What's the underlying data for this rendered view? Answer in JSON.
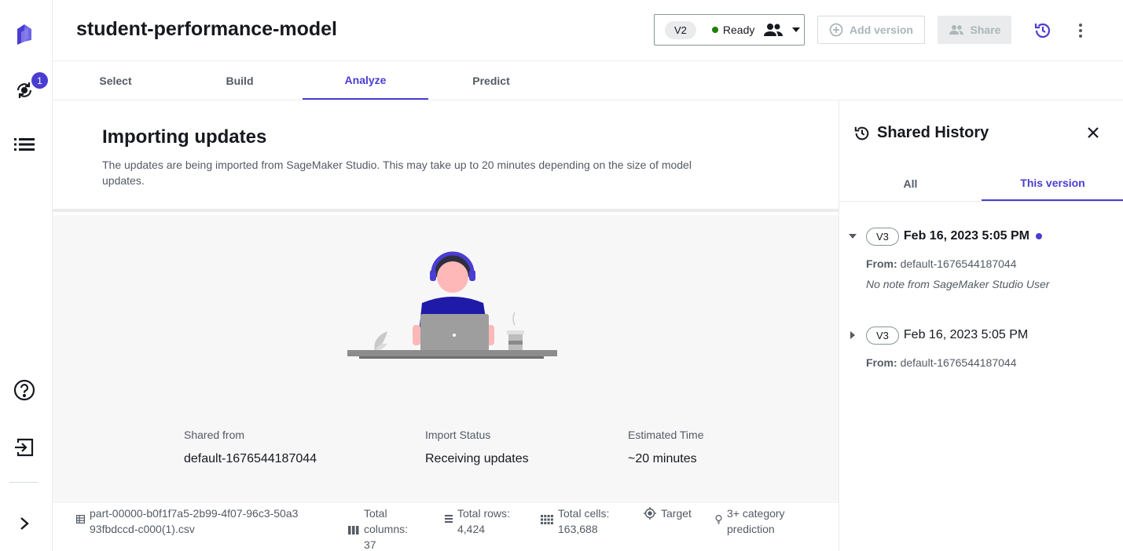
{
  "header": {
    "model_name": "student-performance-model",
    "version": "V2",
    "status": "Ready",
    "add_version_label": "Add version",
    "share_label": "Share"
  },
  "rail": {
    "notification_count": "1"
  },
  "tabs": [
    {
      "label": "Select"
    },
    {
      "label": "Build"
    },
    {
      "label": "Analyze"
    },
    {
      "label": "Predict"
    }
  ],
  "importing": {
    "title": "Importing updates",
    "description": "The updates are being imported from SageMaker Studio. This may take up to 20 minutes depending on the size of model updates.",
    "stats": [
      {
        "label": "Shared from",
        "value": "default-1676544187044"
      },
      {
        "label": "Import Status",
        "value": "Receiving updates"
      },
      {
        "label": "Estimated Time",
        "value": "~20 minutes"
      }
    ]
  },
  "dataset_footer": {
    "file_name": "part-00000-b0f1f7a5-2b99-4f07-96c3-50a393fbdccd-c000(1).csv",
    "total_columns_label": "Total columns:",
    "total_columns": "37",
    "total_rows_label": "Total rows:",
    "total_rows": "4,424",
    "total_cells_label": "Total cells:",
    "total_cells": "163,688",
    "target_label": "Target",
    "problem_type": "3+ category prediction"
  },
  "history_panel": {
    "title": "Shared History",
    "tabs": [
      {
        "label": "All"
      },
      {
        "label": "This version"
      }
    ],
    "entries": [
      {
        "version": "V3",
        "date": "Feb 16, 2023 5:05 PM",
        "from_label": "From:",
        "from": "default-1676544187044",
        "note": "No note from SageMaker Studio User"
      },
      {
        "version": "V3",
        "date": "Feb 16, 2023 5:05 PM",
        "from_label": "From:",
        "from": "default-1676544187044"
      }
    ]
  },
  "colors": {
    "accent": "#4a3dd1",
    "ready_green": "#1d8102"
  }
}
